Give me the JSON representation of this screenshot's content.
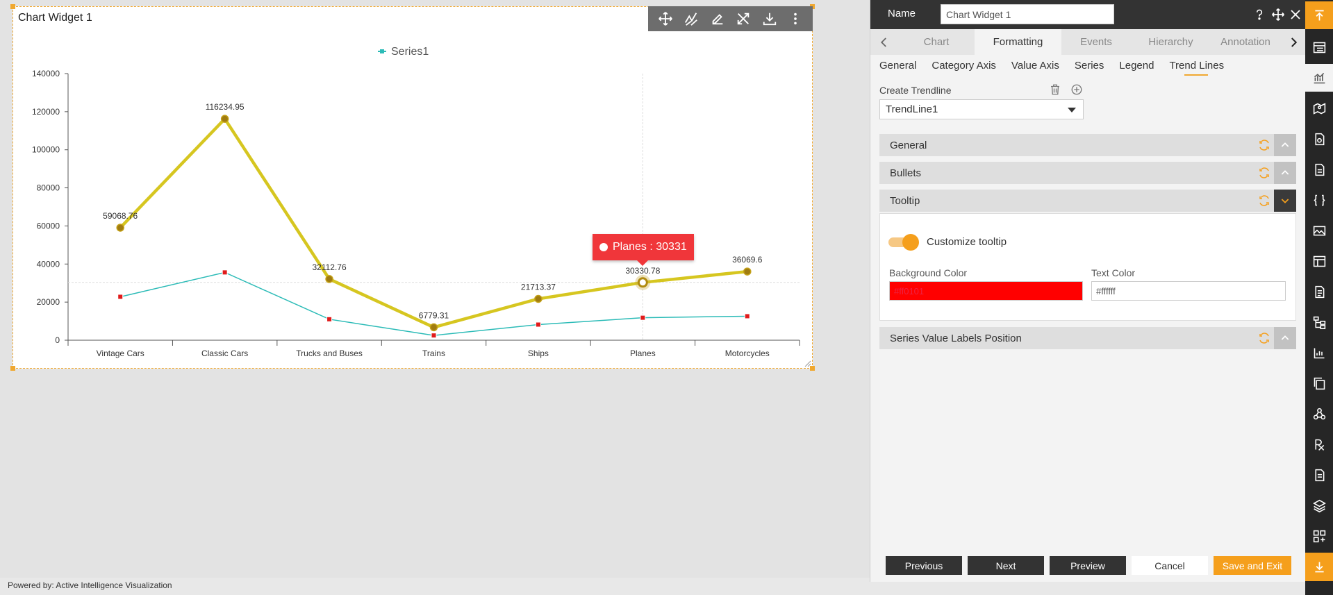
{
  "widget": {
    "title": "Chart Widget 1",
    "toolbar_icons": [
      "move-icon",
      "trendline-icon",
      "edit-icon",
      "tools-icon",
      "download-icon",
      "more-icon"
    ]
  },
  "chart_data": {
    "type": "line",
    "categories": [
      "Vintage Cars",
      "Classic Cars",
      "Trucks and Buses",
      "Trains",
      "Ships",
      "Planes",
      "Motorcycles"
    ],
    "series": [
      {
        "name": "Series1",
        "values": [
          22800,
          35600,
          11000,
          2500,
          8200,
          11800,
          12600
        ],
        "color": "#2bbbb7"
      }
    ],
    "trendline": {
      "values": [
        59068.76,
        116234.95,
        32112.76,
        6779.31,
        21713.37,
        30330.78,
        36069.6
      ],
      "labels": [
        "59068.76",
        "116234.95",
        "32112.76",
        "6779.31",
        "21713.37",
        "30330.78",
        "36069.6"
      ],
      "color": "#d6c620"
    },
    "ylim": [
      0,
      140000
    ],
    "yticks": [
      "0",
      "20000",
      "40000",
      "60000",
      "80000",
      "100000",
      "120000",
      "140000"
    ],
    "legend": "top",
    "tooltip_text": "Planes : 30331"
  },
  "panel": {
    "name_label": "Name",
    "name_value": "Chart Widget 1",
    "tabs": [
      "Chart",
      "Formatting",
      "Events",
      "Hierarchy",
      "Annotation"
    ],
    "active_tab": "Formatting",
    "subtabs": [
      "General",
      "Category Axis",
      "Value Axis",
      "Series",
      "Legend",
      "Trend Lines"
    ],
    "active_subtab": "Trend Lines",
    "create_trendline_label": "Create Trendline",
    "trendline_selected": "TrendLine1",
    "sections": {
      "general": "General",
      "bullets": "Bullets",
      "tooltip": "Tooltip",
      "series_labels": "Series Value Labels Position"
    },
    "tooltip": {
      "customize_label": "Customize tooltip",
      "customize_on": true,
      "bg_label": "Background Color",
      "bg_value": "#ff0101",
      "text_label": "Text Color",
      "text_value": "#ffffff"
    },
    "buttons": {
      "previous": "Previous",
      "next": "Next",
      "preview": "Preview",
      "cancel": "Cancel",
      "save_exit": "Save and Exit"
    }
  },
  "footer": {
    "powered_by": "Powered by: Active Intelligence Visualization"
  },
  "colors": {
    "accent": "#f59f1c",
    "tooltip_bg": "#f0363a",
    "dark": "#333333"
  }
}
